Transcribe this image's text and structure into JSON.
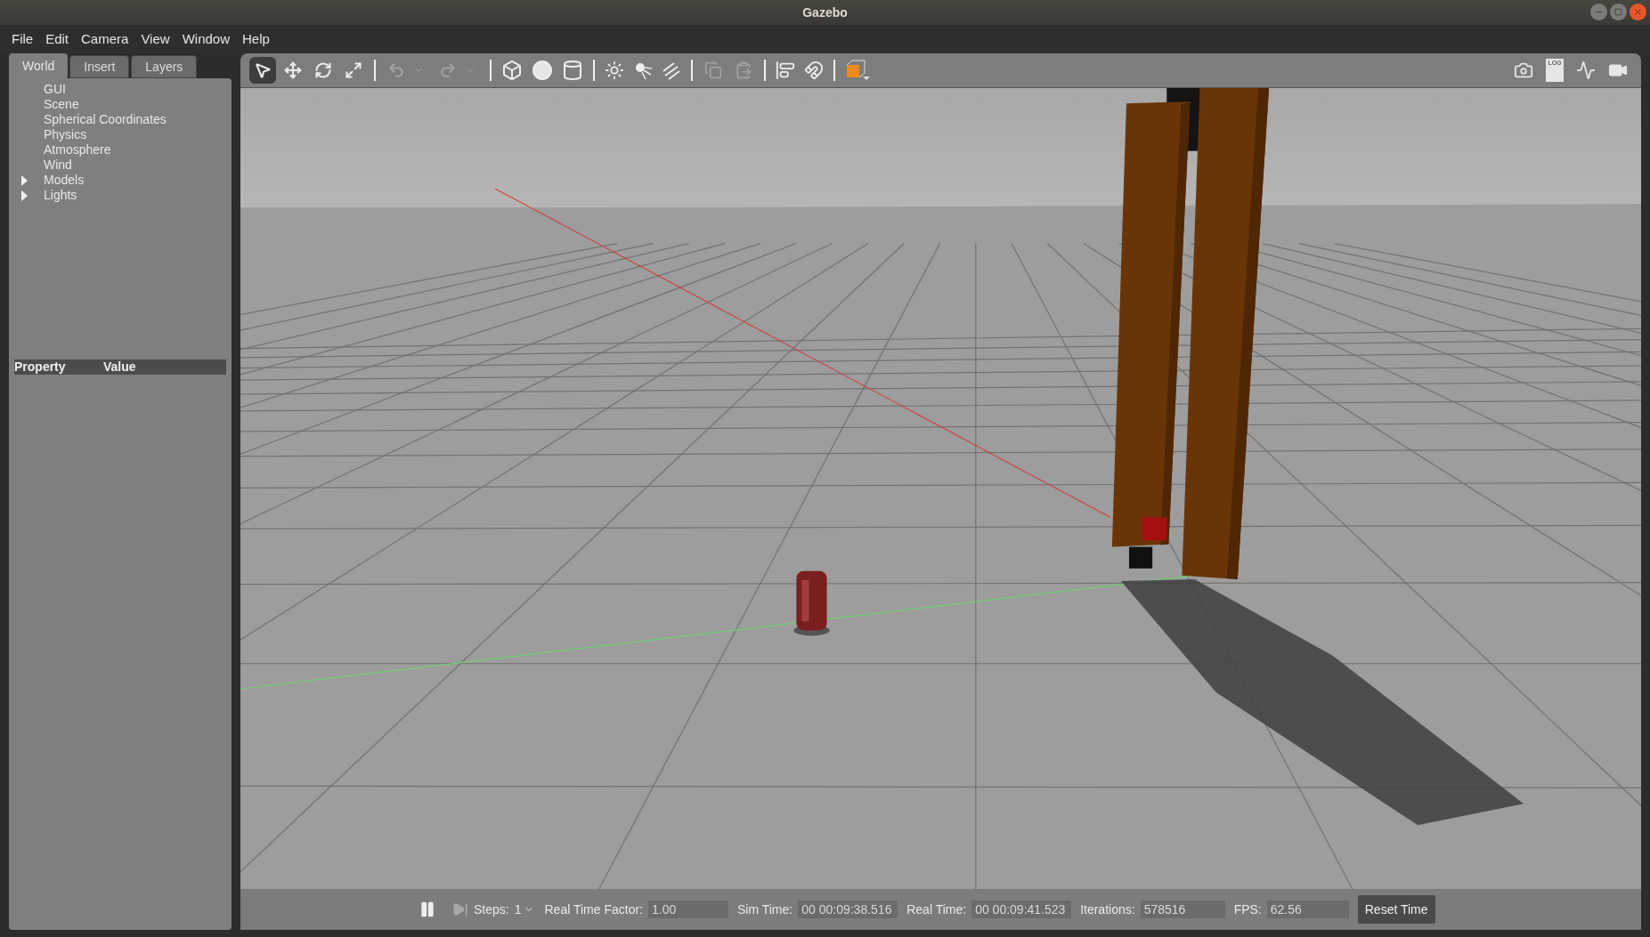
{
  "window": {
    "title": "Gazebo"
  },
  "menu": [
    "File",
    "Edit",
    "Camera",
    "View",
    "Window",
    "Help"
  ],
  "left_panel": {
    "tabs": [
      {
        "label": "World",
        "selected": true
      },
      {
        "label": "Insert",
        "selected": false
      },
      {
        "label": "Layers",
        "selected": false
      }
    ],
    "tree": [
      {
        "label": "GUI",
        "kind": "leaf"
      },
      {
        "label": "Scene",
        "kind": "leaf"
      },
      {
        "label": "Spherical Coordinates",
        "kind": "leaf"
      },
      {
        "label": "Physics",
        "kind": "leaf"
      },
      {
        "label": "Atmosphere",
        "kind": "leaf"
      },
      {
        "label": "Wind",
        "kind": "leaf"
      },
      {
        "label": "Models",
        "kind": "group",
        "expanded": false
      },
      {
        "label": "Lights",
        "kind": "group",
        "expanded": false
      }
    ],
    "property_columns": [
      "Property",
      "Value"
    ]
  },
  "toolbar": {
    "modes": [
      {
        "kind": "select",
        "selected": true
      },
      {
        "kind": "translate",
        "selected": false
      },
      {
        "kind": "rotate",
        "selected": false
      },
      {
        "kind": "scale",
        "selected": false
      }
    ],
    "history": [
      {
        "kind": "undo",
        "disabled": true
      },
      {
        "kind": "redo",
        "disabled": true
      }
    ],
    "clipboard": [
      {
        "kind": "copy",
        "disabled": true
      },
      {
        "kind": "paste",
        "disabled": true
      }
    ],
    "log_label": "LOG"
  },
  "status_bar": {
    "steps_label": "Steps:",
    "steps_value": "1",
    "fields": [
      {
        "label": "Real Time Factor:",
        "value": "1.00"
      },
      {
        "label": "Sim Time:",
        "value": "00 00:09:38.516"
      },
      {
        "label": "Real Time:",
        "value": "00 00:09:41.523"
      },
      {
        "label": "Iterations:",
        "value": "578516"
      },
      {
        "label": "FPS:",
        "value": "62.56"
      }
    ],
    "reset_button": "Reset Time"
  }
}
